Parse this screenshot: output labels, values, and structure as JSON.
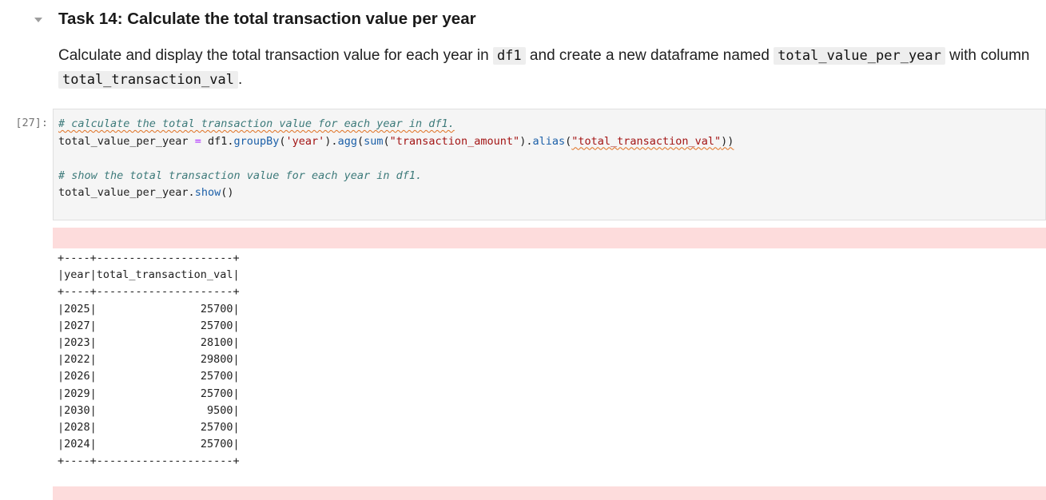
{
  "markdown_cell": {
    "heading": "Task 14: Calculate the total transaction value per year",
    "description": {
      "part1": "Calculate and display the total transaction value for each year in ",
      "code1": "df1",
      "part2": " and create a new dataframe named ",
      "code2": "total_value_per_year",
      "part3": " with column ",
      "code3": "total_transaction_val",
      "part4": "."
    },
    "collapse_icon": "caret-down-icon"
  },
  "code_cell": {
    "prompt": "[27]:",
    "line1_comment": "# calculate the total transaction value for each year in df1.",
    "line2": {
      "var": "total_value_per_year",
      "assign": " = ",
      "obj": "df1.",
      "groupby": "groupBy",
      "paren_open": "(",
      "arg_year": "'year'",
      "dot_agg": ").",
      "agg": "agg",
      "paren2": "(",
      "sum": "sum",
      "paren3": "(",
      "arg_amount": "\"transaction_amount\"",
      "dot_alias": ").",
      "alias": "alias",
      "paren4": "(",
      "arg_alias": "\"total_transaction_val\"",
      "close": "))"
    },
    "line4_comment": "# show the total transaction value for each year in df1.",
    "line5": {
      "var": "total_value_per_year.",
      "show": "show",
      "parens": "()"
    }
  },
  "output": {
    "border": "+----+---------------------+",
    "header": "|year|total_transaction_val|",
    "rows": [
      {
        "year": "2025",
        "total": "25700"
      },
      {
        "year": "2027",
        "total": "25700"
      },
      {
        "year": "2023",
        "total": "28100"
      },
      {
        "year": "2022",
        "total": "29800"
      },
      {
        "year": "2026",
        "total": "25700"
      },
      {
        "year": "2029",
        "total": "25700"
      },
      {
        "year": "2030",
        "total": "9500"
      },
      {
        "year": "2028",
        "total": "25700"
      },
      {
        "year": "2024",
        "total": "25700"
      }
    ]
  },
  "colors": {
    "stderr_background": "#fddcdc",
    "code_background": "#f5f5f5",
    "comment": "#3d7a7a",
    "string": "#a31515"
  }
}
